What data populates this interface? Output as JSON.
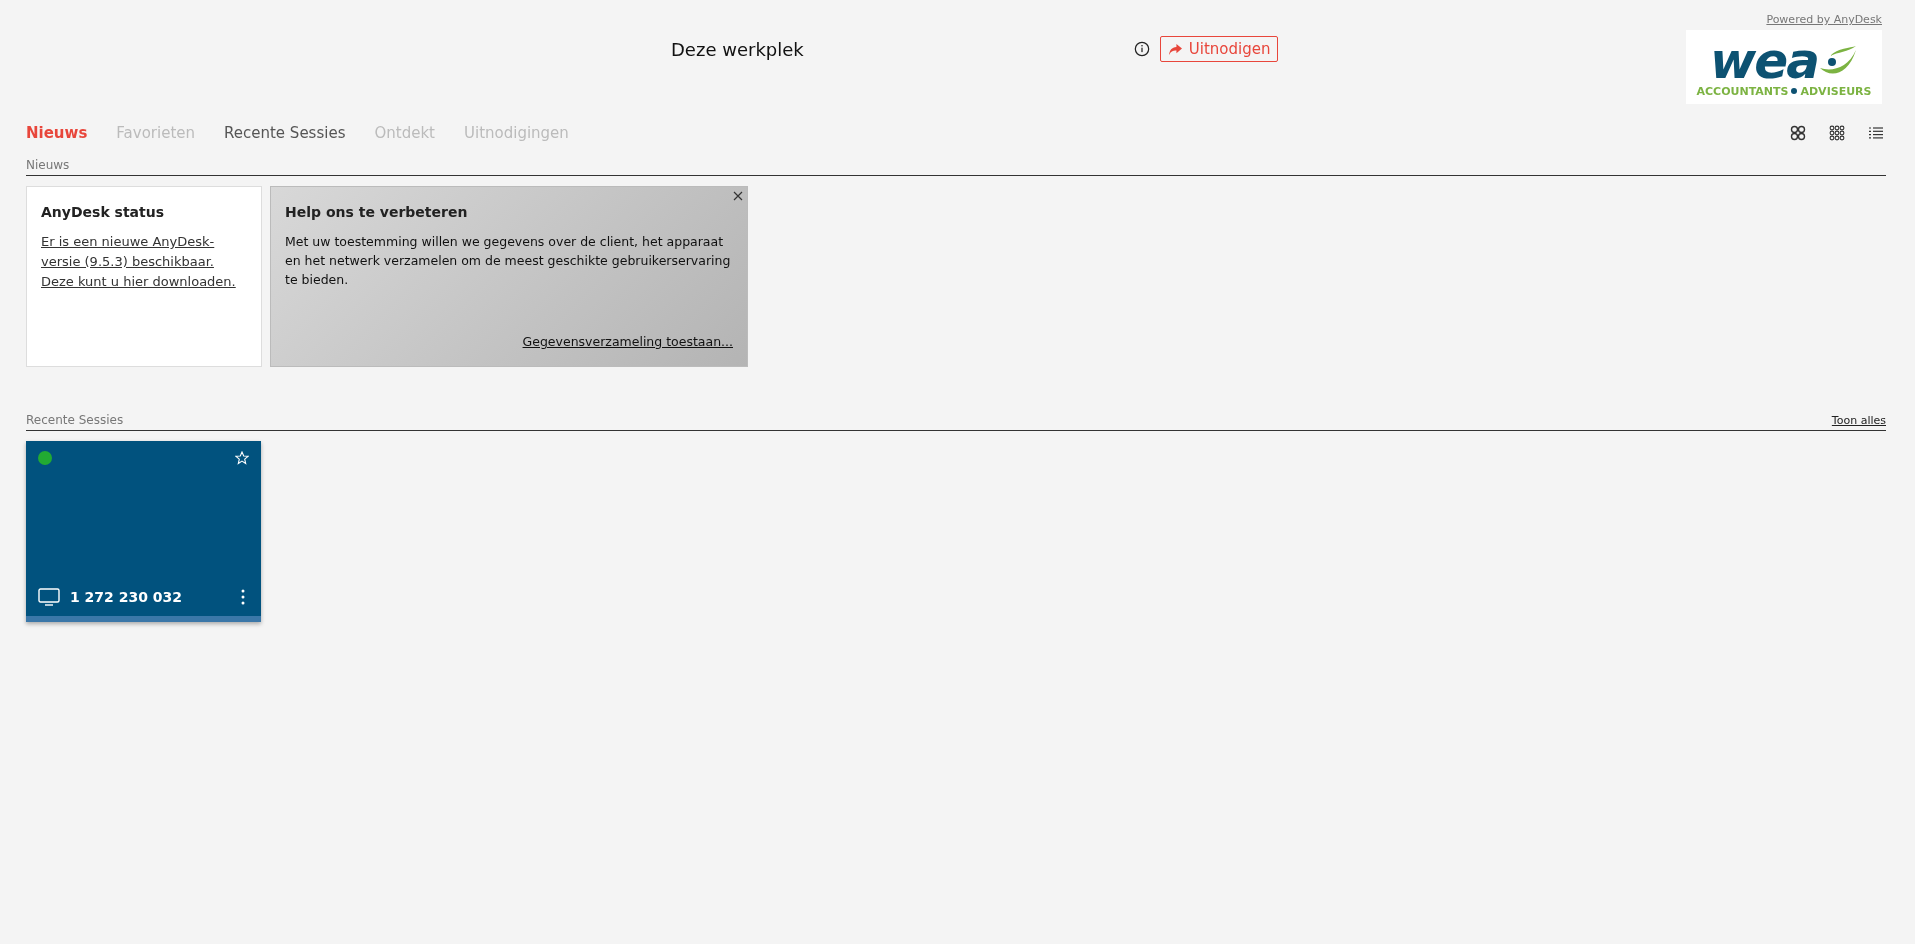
{
  "header": {
    "powered_by": "Powered by AnyDesk",
    "workplace_title": "Deze werkplek",
    "invite_button": "Uitnodigen",
    "logo": {
      "wordmark": "wea",
      "tagline_left": "ACCOUNTANTS",
      "tagline_right": "ADVISEURS"
    }
  },
  "tabs": [
    {
      "label": "Nieuws",
      "selected": true,
      "disabled": false
    },
    {
      "label": "Favorieten",
      "selected": false,
      "disabled": true
    },
    {
      "label": "Recente Sessies",
      "selected": false,
      "disabled": false
    },
    {
      "label": "Ontdekt",
      "selected": false,
      "disabled": true
    },
    {
      "label": "Uitnodigingen",
      "selected": false,
      "disabled": true
    }
  ],
  "view_modes": [
    {
      "kind": "large-tiles",
      "selected": false
    },
    {
      "kind": "small-tiles",
      "selected": false
    },
    {
      "kind": "list",
      "selected": false
    }
  ],
  "news": {
    "heading": "Nieuws",
    "cards": [
      {
        "kind": "plain",
        "title": "AnyDesk status",
        "link": "Er is een nieuwe AnyDesk-versie (9.5.3) beschikbaar. Deze kunt u hier downloaden."
      },
      {
        "kind": "prompt",
        "title": "Help ons te verbeteren",
        "body": "Met uw toestemming willen we gegevens over de client, het apparaat en het netwerk verzamelen om de meest geschikte gebruikerservaring te bieden.",
        "action": "Gegevensverzameling toestaan...",
        "closable": true
      }
    ]
  },
  "recent_sessions": {
    "heading": "Recente Sessies",
    "show_all": "Toon alles",
    "sessions": [
      {
        "address": "1 272 230 032",
        "online": true,
        "favorite": false
      }
    ]
  }
}
